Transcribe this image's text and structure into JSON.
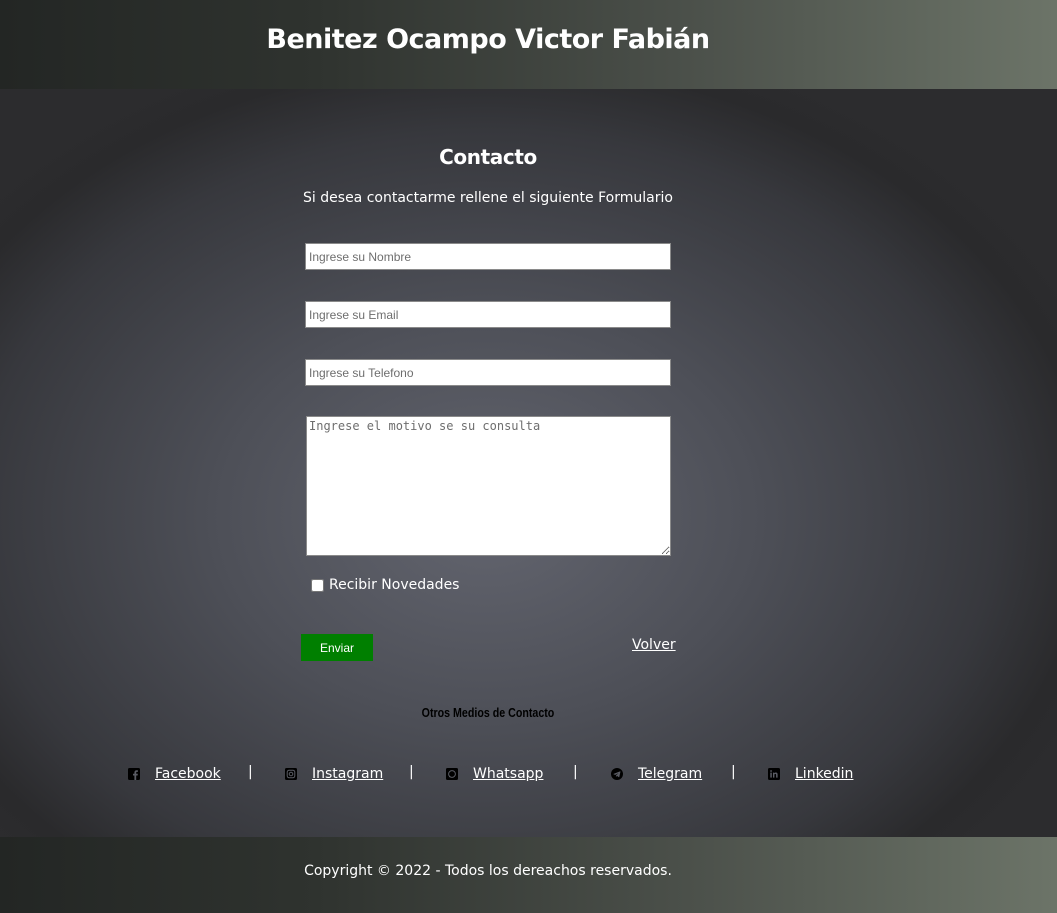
{
  "header": {
    "title": "Benitez Ocampo Victor Fabián"
  },
  "contact": {
    "title": "Contacto",
    "subtitle": "Si desea contactarme rellene el siguiente Formulario",
    "name_placeholder": "Ingrese su Nombre",
    "email_placeholder": "Ingrese su Email",
    "phone_placeholder": "Ingrese su Telefono",
    "message_placeholder": "Ingrese el motivo se su consulta",
    "newsletter_label": "Recibir Novedades",
    "newsletter_checked": false,
    "send_label": "Enviar",
    "back_label": "Volver",
    "send_color": "#007f00"
  },
  "other": {
    "title": "Otros Medios de Contacto",
    "separator": "|",
    "links": [
      {
        "label": "Facebook",
        "icon": "facebook-icon"
      },
      {
        "label": "Instagram",
        "icon": "instagram-icon"
      },
      {
        "label": "Whatsapp",
        "icon": "whatsapp-icon"
      },
      {
        "label": "Telegram",
        "icon": "telegram-icon"
      },
      {
        "label": "Linkedin",
        "icon": "linkedin-icon"
      }
    ]
  },
  "footer": {
    "copyright": "Copyright © 2022 - Todos los dereachos reservados."
  }
}
